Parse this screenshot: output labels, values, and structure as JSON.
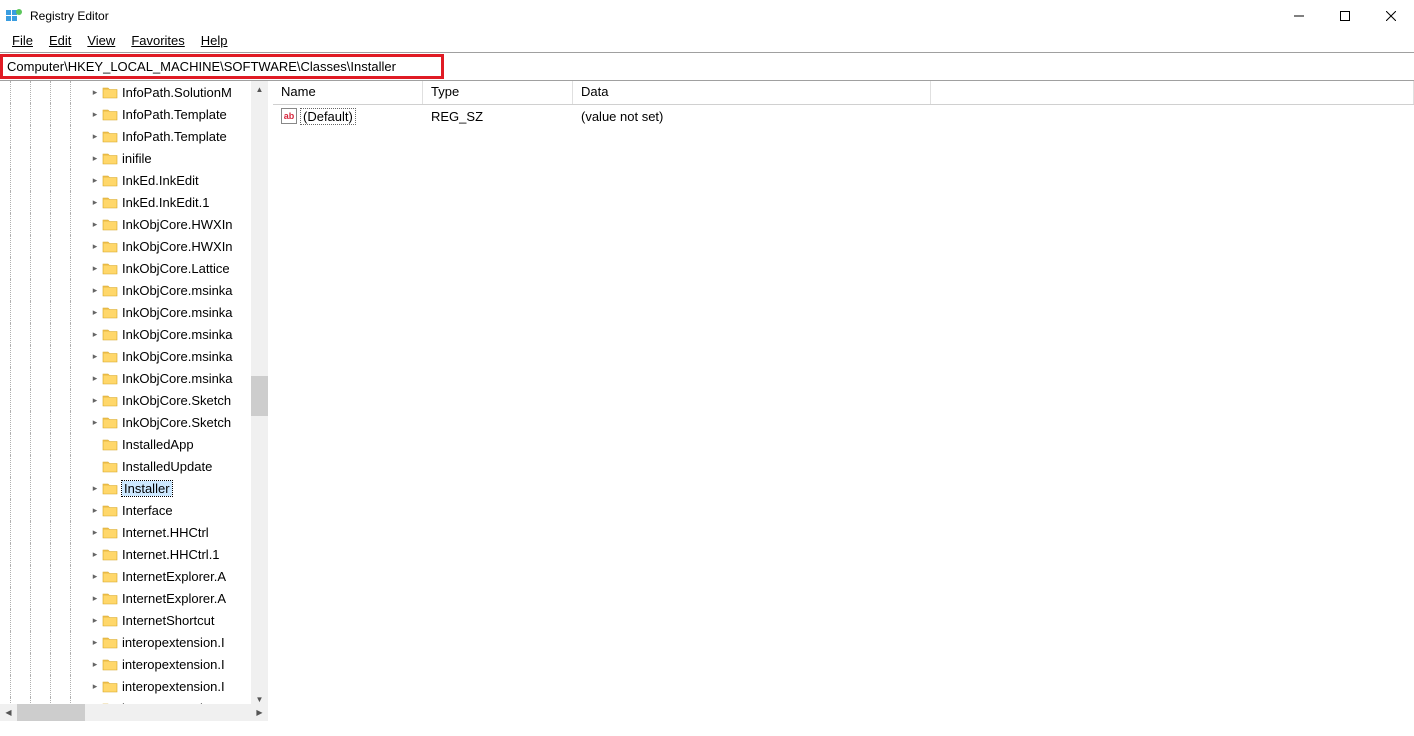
{
  "window": {
    "title": "Registry Editor"
  },
  "menu": {
    "file": "File",
    "edit": "Edit",
    "view": "View",
    "favorites": "Favorites",
    "help": "Help"
  },
  "address": "Computer\\HKEY_LOCAL_MACHINE\\SOFTWARE\\Classes\\Installer",
  "tree": {
    "items": [
      {
        "label": "InfoPath.SolutionM",
        "expander": ">",
        "selected": false
      },
      {
        "label": "InfoPath.Template",
        "expander": ">",
        "selected": false
      },
      {
        "label": "InfoPath.Template",
        "expander": ">",
        "selected": false
      },
      {
        "label": "inifile",
        "expander": ">",
        "selected": false
      },
      {
        "label": "InkEd.InkEdit",
        "expander": ">",
        "selected": false
      },
      {
        "label": "InkEd.InkEdit.1",
        "expander": ">",
        "selected": false
      },
      {
        "label": "InkObjCore.HWXIn",
        "expander": ">",
        "selected": false
      },
      {
        "label": "InkObjCore.HWXIn",
        "expander": ">",
        "selected": false
      },
      {
        "label": "InkObjCore.Lattice",
        "expander": ">",
        "selected": false
      },
      {
        "label": "InkObjCore.msinka",
        "expander": ">",
        "selected": false
      },
      {
        "label": "InkObjCore.msinka",
        "expander": ">",
        "selected": false
      },
      {
        "label": "InkObjCore.msinka",
        "expander": ">",
        "selected": false
      },
      {
        "label": "InkObjCore.msinka",
        "expander": ">",
        "selected": false
      },
      {
        "label": "InkObjCore.msinka",
        "expander": ">",
        "selected": false
      },
      {
        "label": "InkObjCore.Sketch",
        "expander": ">",
        "selected": false
      },
      {
        "label": "InkObjCore.Sketch",
        "expander": ">",
        "selected": false
      },
      {
        "label": "InstalledApp",
        "expander": "",
        "selected": false
      },
      {
        "label": "InstalledUpdate",
        "expander": "",
        "selected": false
      },
      {
        "label": "Installer",
        "expander": ">",
        "selected": true
      },
      {
        "label": "Interface",
        "expander": ">",
        "selected": false
      },
      {
        "label": "Internet.HHCtrl",
        "expander": ">",
        "selected": false
      },
      {
        "label": "Internet.HHCtrl.1",
        "expander": ">",
        "selected": false
      },
      {
        "label": "InternetExplorer.A",
        "expander": ">",
        "selected": false
      },
      {
        "label": "InternetExplorer.A",
        "expander": ">",
        "selected": false
      },
      {
        "label": "InternetShortcut",
        "expander": ">",
        "selected": false
      },
      {
        "label": "interopextension.I",
        "expander": ">",
        "selected": false
      },
      {
        "label": "interopextension.I",
        "expander": ">",
        "selected": false
      },
      {
        "label": "interopextension.I",
        "expander": ">",
        "selected": false
      },
      {
        "label": "interopextension.I",
        "expander": ">",
        "selected": false
      }
    ]
  },
  "list": {
    "columns": {
      "name": "Name",
      "type": "Type",
      "data": "Data"
    },
    "rows": [
      {
        "name": "(Default)",
        "type": "REG_SZ",
        "data": "(value not set)"
      }
    ]
  },
  "icon_text": {
    "ab": "ab"
  }
}
